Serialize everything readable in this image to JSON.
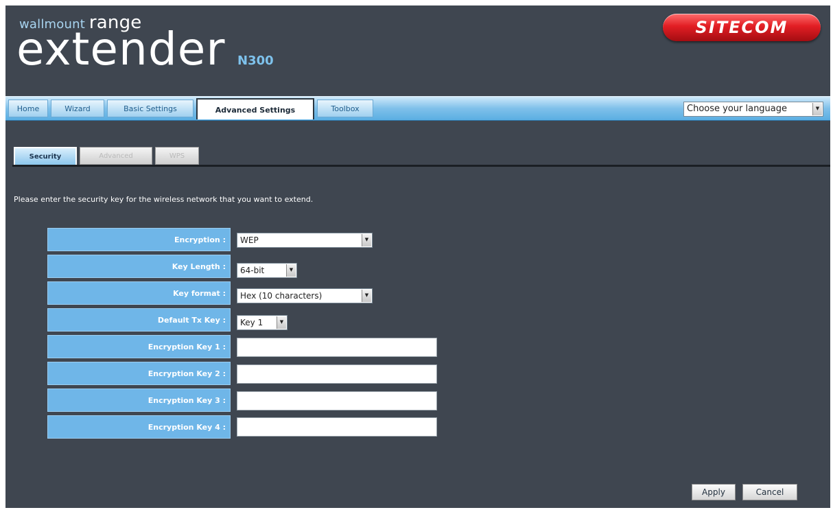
{
  "header": {
    "brand_small": "wallmount",
    "brand_range": "range",
    "brand_big": "extender",
    "model": "N300",
    "logo": "SITECOM"
  },
  "nav": {
    "items": [
      {
        "label": "Home"
      },
      {
        "label": "Wizard"
      },
      {
        "label": "Basic Settings"
      },
      {
        "label": "Advanced Settings",
        "active": true
      },
      {
        "label": "Toolbox"
      }
    ],
    "language_select": "Choose your language"
  },
  "subtabs": [
    {
      "label": "Security",
      "active": true
    },
    {
      "label": "Advanced"
    },
    {
      "label": "WPS"
    }
  ],
  "instruction": "Please enter the security key for the wireless network that you want to extend.",
  "form": {
    "encryption": {
      "label": "Encryption :",
      "value": "WEP"
    },
    "key_length": {
      "label": "Key Length :",
      "value": "64-bit"
    },
    "key_format": {
      "label": "Key format :",
      "value": "Hex (10 characters)"
    },
    "default_tx_key": {
      "label": "Default Tx Key :",
      "value": "Key 1"
    },
    "keys": [
      {
        "label": "Encryption Key 1 :",
        "value": ""
      },
      {
        "label": "Encryption Key 2 :",
        "value": ""
      },
      {
        "label": "Encryption Key 3 :",
        "value": ""
      },
      {
        "label": "Encryption Key 4 :",
        "value": ""
      }
    ]
  },
  "buttons": {
    "apply": "Apply",
    "cancel": "Cancel"
  },
  "colors": {
    "background": "#3f4650",
    "label_blue": "#6fb6e8",
    "nav_blue": "#7fc0ea",
    "logo_red": "#e21e24"
  }
}
